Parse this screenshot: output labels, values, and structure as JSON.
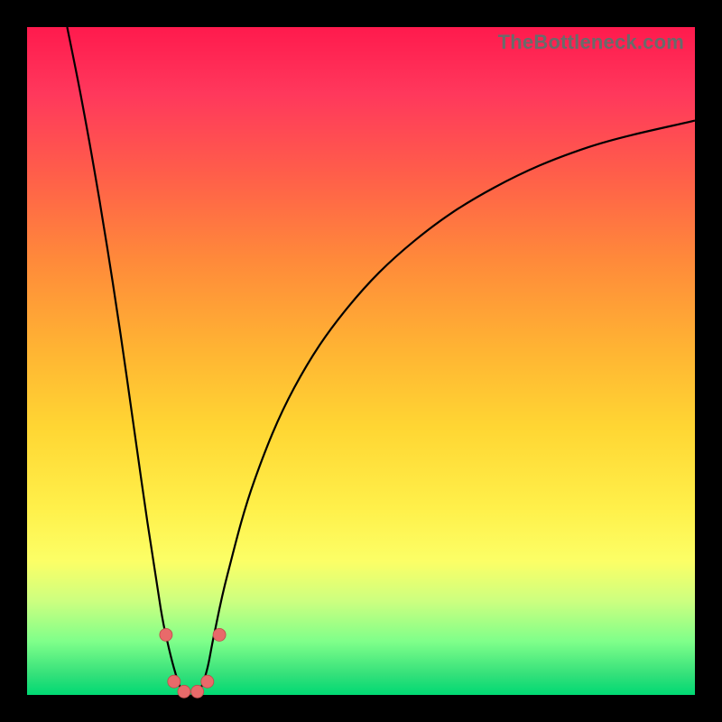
{
  "attribution": "TheBottleneck.com",
  "colors": {
    "frame": "#000000",
    "gradient_top": "#ff1a4d",
    "gradient_bottom": "#00d973",
    "curve": "#000000",
    "marker": "#e86a6a"
  },
  "chart_data": {
    "type": "line",
    "title": "",
    "xlabel": "",
    "ylabel": "",
    "xlim": [
      0,
      100
    ],
    "ylim": [
      0,
      100
    ],
    "grid": false,
    "legend": false,
    "series": [
      {
        "name": "bottleneck-curve",
        "x": [
          6,
          8,
          10,
          12,
          14,
          16,
          18,
          20,
          21,
          22,
          23,
          24,
          25,
          26,
          27,
          28,
          30,
          34,
          40,
          48,
          58,
          70,
          84,
          100
        ],
        "y": [
          100,
          90,
          79,
          67,
          54,
          40,
          26,
          13,
          8,
          4,
          1,
          0,
          0,
          1,
          4,
          9,
          18,
          32,
          46,
          58,
          68,
          76,
          82,
          86
        ]
      }
    ],
    "markers": [
      {
        "x": 20.8,
        "y": 9
      },
      {
        "x": 22.0,
        "y": 2
      },
      {
        "x": 23.5,
        "y": 0.5
      },
      {
        "x": 25.5,
        "y": 0.5
      },
      {
        "x": 27.0,
        "y": 2
      },
      {
        "x": 28.8,
        "y": 9
      }
    ]
  }
}
